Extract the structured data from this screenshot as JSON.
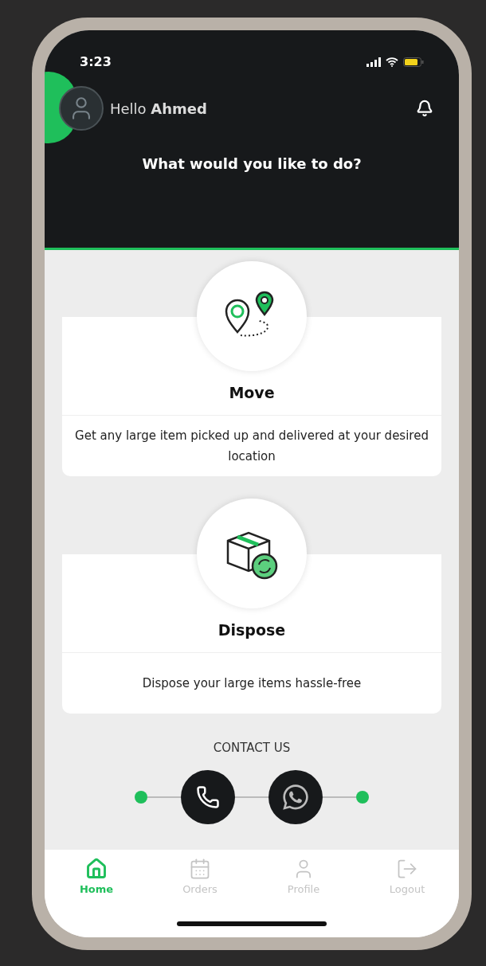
{
  "status_bar": {
    "time": "3:23"
  },
  "header": {
    "greeting": "Hello **Ahmed**",
    "prompt": "What would you like to do?"
  },
  "services": [
    {
      "kind": "move",
      "title": "Move",
      "description": "Get any large item picked up and delivered at your desired location"
    },
    {
      "kind": "dispose",
      "title": "Dispose",
      "description": "Dispose your large items hassle-free"
    }
  ],
  "contact": {
    "title": "CONTACT US",
    "buttons": [
      {
        "kind": "phone"
      },
      {
        "kind": "whatsapp"
      }
    ]
  },
  "nav": [
    {
      "kind": "home",
      "label": "Home",
      "selected": true
    },
    {
      "kind": "orders",
      "label": "Orders",
      "selected": false
    },
    {
      "kind": "profile",
      "label": "Profile",
      "selected": false
    },
    {
      "kind": "logout",
      "label": "Logout",
      "selected": false
    }
  ]
}
